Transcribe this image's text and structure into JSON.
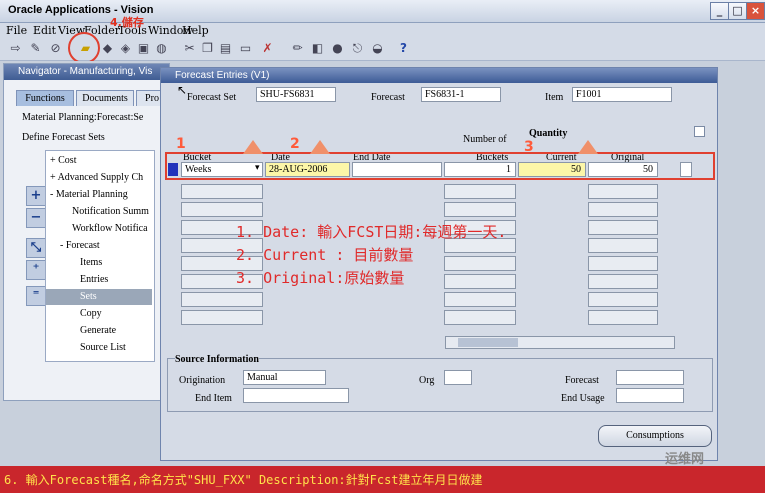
{
  "app": {
    "title": "Oracle Applications - Vision"
  },
  "menu": [
    "File",
    "Edit",
    "View",
    "Folder",
    "Tools",
    "Window",
    "Help"
  ],
  "toolbar_callout": "4.儲存",
  "navigator": {
    "title": "Navigator - Manufacturing, Vis",
    "tabs": [
      "Functions",
      "Documents",
      "Pro"
    ],
    "context": "Material Planning:Forecast:Se",
    "define": "Define Forecast Sets",
    "items": [
      "+ Cost",
      "+ Advanced Supply Ch",
      "- Material Planning",
      "Notification Summ",
      "Workflow Notifica",
      "- Forecast",
      "Items",
      "Entries",
      "Sets",
      "Copy",
      "Generate",
      "Source List"
    ]
  },
  "forecast_entries": {
    "title": "Forecast Entries (V1)",
    "forecast_set_label": "Forecast Set",
    "forecast_set": "SHU-FS6831",
    "forecast_label": "Forecast",
    "forecast": "FS6831-1",
    "item_label": "Item",
    "item": "F1001",
    "number_of_label": "Number of",
    "quantity_label": "Quantity",
    "columns": {
      "bucket": "Bucket",
      "date": "Date",
      "end_date": "End Date",
      "buckets": "Buckets",
      "current": "Current",
      "original": "Original"
    },
    "row1": {
      "bucket": "Weeks",
      "date": "28-AUG-2006",
      "end_date": "",
      "buckets": "1",
      "current": "50",
      "original": "50"
    },
    "source_info_label": "Source Information",
    "origination_label": "Origination",
    "origination": "Manual",
    "org_label": "Org",
    "forecast2_label": "Forecast",
    "end_item_label": "End Item",
    "end_usage_label": "End Usage",
    "consumptions_button": "Consumptions"
  },
  "annotations": {
    "num1": "1",
    "num2": "2",
    "num3": "3",
    "line1": "1. Date: 輸入FCST日期:每週第一天.",
    "line2": "2. Current : 目前數量",
    "line3": "3. Original:原始數量"
  },
  "bottom_note": "6. 輸入Forecast種名,命名方式\"SHU_FXX\" Description:針對Fcst建立年月日做建",
  "watermark": "运维网"
}
